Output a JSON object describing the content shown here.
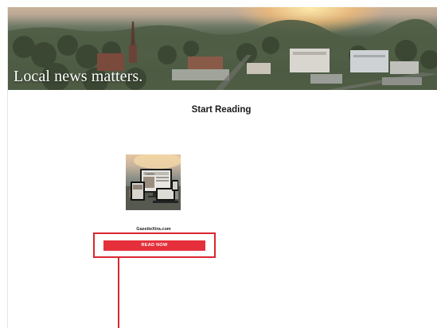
{
  "hero": {
    "caption": "Local news matters."
  },
  "section": {
    "title": "Start Reading"
  },
  "product": {
    "image_label": "Gazette",
    "name": "GazetteXtra.com",
    "button_label": "READ NOW"
  },
  "annotation": {
    "color": "#d9262f"
  },
  "colors": {
    "button": "#e5303b",
    "background": "#ffffff"
  }
}
